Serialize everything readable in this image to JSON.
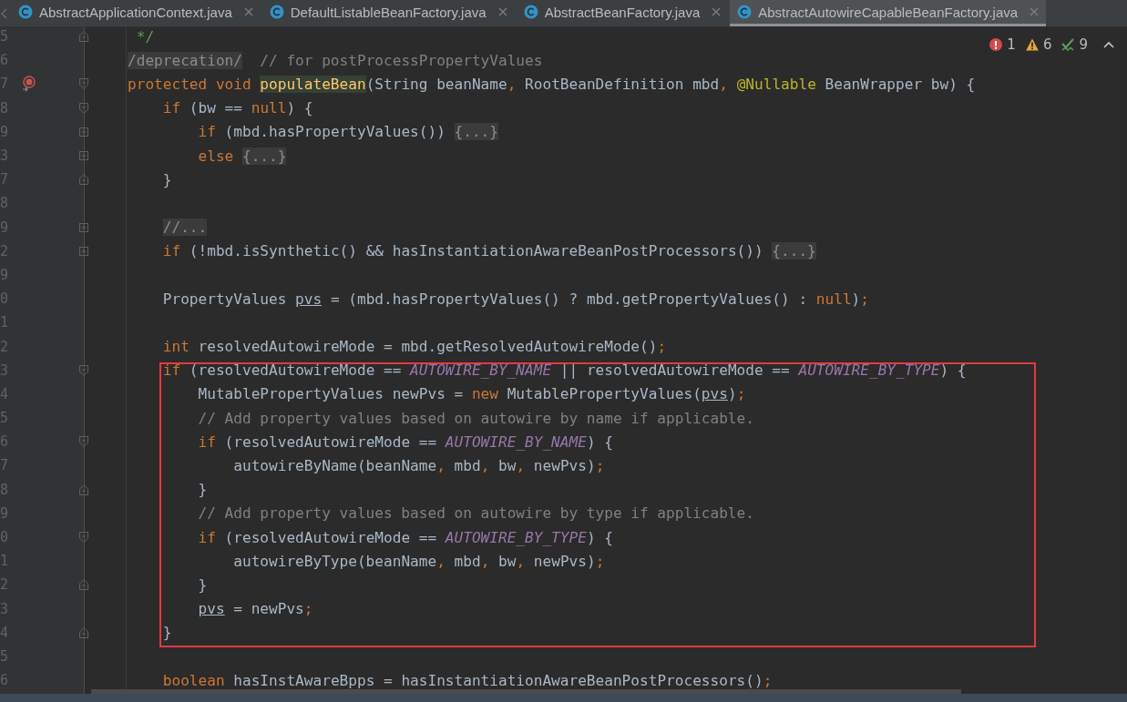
{
  "tabs": [
    {
      "label": "AbstractApplicationContext.java",
      "selected": false
    },
    {
      "label": "DefaultListableBeanFactory.java",
      "selected": false
    },
    {
      "label": "AbstractBeanFactory.java",
      "selected": false
    },
    {
      "label": "AbstractAutowireCapableBeanFactory.java",
      "selected": true
    }
  ],
  "inspections": {
    "errors": "1",
    "warnings": "6",
    "weak_warnings": "9"
  },
  "lines": [
    {
      "number": "5",
      "fold_end": true,
      "tokens": [
        {
          "kind": "doc",
          "text": " */"
        }
      ]
    },
    {
      "number": "6",
      "tokens": [
        {
          "kind": "fold",
          "text": "/deprecation/"
        },
        {
          "kind": "comment",
          "text": "  // for postProcessPropertyValues"
        }
      ]
    },
    {
      "number": "7",
      "override_marker": true,
      "fold_start": true,
      "tokens": [
        {
          "kind": "keyword",
          "text": "protected void "
        },
        {
          "kind": "declaration",
          "text": "populateBean"
        },
        {
          "kind": "plain",
          "text": "(String beanName"
        },
        {
          "kind": "punct",
          "text": ","
        },
        {
          "kind": "plain",
          "text": " RootBeanDefinition mbd"
        },
        {
          "kind": "punct",
          "text": ", "
        },
        {
          "kind": "annotation",
          "text": "@Nullable"
        },
        {
          "kind": "plain",
          "text": " BeanWrapper bw) {"
        }
      ]
    },
    {
      "number": "8",
      "fold_start": true,
      "tokens": [
        {
          "kind": "keyword",
          "text": "    if"
        },
        {
          "kind": "plain",
          "text": " (bw == "
        },
        {
          "kind": "keyword",
          "text": "null"
        },
        {
          "kind": "plain",
          "text": ") {"
        }
      ]
    },
    {
      "number": "9",
      "collapsed": true,
      "tokens": [
        {
          "kind": "keyword",
          "text": "        if"
        },
        {
          "kind": "plain",
          "text": " (mbd.hasPropertyValues()) "
        },
        {
          "kind": "fold",
          "text": "{...}"
        }
      ]
    },
    {
      "number": "3",
      "collapsed": true,
      "tokens": [
        {
          "kind": "keyword",
          "text": "        else "
        },
        {
          "kind": "fold",
          "text": "{...}"
        }
      ]
    },
    {
      "number": "7",
      "fold_end": true,
      "tokens": [
        {
          "kind": "plain",
          "text": "    }"
        }
      ]
    },
    {
      "number": "8"
    },
    {
      "number": "9",
      "collapsed": true,
      "tokens": [
        {
          "kind": "fold",
          "text": "    //..."
        }
      ]
    },
    {
      "number": "2",
      "collapsed": true,
      "tokens": [
        {
          "kind": "keyword",
          "text": "    if"
        },
        {
          "kind": "plain",
          "text": " (!mbd.isSynthetic() && hasInstantiationAwareBeanPostProcessors()) "
        },
        {
          "kind": "fold",
          "text": "{...}"
        }
      ]
    },
    {
      "number": "9"
    },
    {
      "number": "0",
      "tokens": [
        {
          "kind": "plain",
          "text": "    PropertyValues "
        },
        {
          "kind": "unused",
          "text": "pvs"
        },
        {
          "kind": "plain",
          "text": " = (mbd.hasPropertyValues() ? mbd.getPropertyValues() : "
        },
        {
          "kind": "keyword",
          "text": "null"
        },
        {
          "kind": "plain",
          "text": ")"
        },
        {
          "kind": "punct",
          "text": ";"
        }
      ]
    },
    {
      "number": "1"
    },
    {
      "number": "2",
      "tokens": [
        {
          "kind": "keyword",
          "text": "    int"
        },
        {
          "kind": "plain",
          "text": " resolvedAutowireMode = mbd.getResolvedAutowireMode()"
        },
        {
          "kind": "punct",
          "text": ";"
        }
      ]
    },
    {
      "number": "3",
      "fold_start": true,
      "tokens": [
        {
          "kind": "keyword",
          "text": "    if"
        },
        {
          "kind": "plain",
          "text": " (resolvedAutowireMode == "
        },
        {
          "kind": "constant",
          "text": "AUTOWIRE_BY_NAME"
        },
        {
          "kind": "plain",
          "text": " || resolvedAutowireMode == "
        },
        {
          "kind": "constant",
          "text": "AUTOWIRE_BY_TYPE"
        },
        {
          "kind": "plain",
          "text": ") {"
        }
      ]
    },
    {
      "number": "4",
      "tokens": [
        {
          "kind": "plain",
          "text": "        MutablePropertyValues newPvs = "
        },
        {
          "kind": "keyword",
          "text": "new"
        },
        {
          "kind": "plain",
          "text": " MutablePropertyValues("
        },
        {
          "kind": "unused",
          "text": "pvs"
        },
        {
          "kind": "plain",
          "text": ")"
        },
        {
          "kind": "punct",
          "text": ";"
        }
      ]
    },
    {
      "number": "5",
      "tokens": [
        {
          "kind": "comment",
          "text": "        // Add property values based on autowire by name if applicable."
        }
      ]
    },
    {
      "number": "6",
      "fold_start": true,
      "tokens": [
        {
          "kind": "keyword",
          "text": "        if"
        },
        {
          "kind": "plain",
          "text": " (resolvedAutowireMode == "
        },
        {
          "kind": "constant",
          "text": "AUTOWIRE_BY_NAME"
        },
        {
          "kind": "plain",
          "text": ") {"
        }
      ]
    },
    {
      "number": "7",
      "tokens": [
        {
          "kind": "plain",
          "text": "            autowireByName(beanName"
        },
        {
          "kind": "punct",
          "text": ","
        },
        {
          "kind": "plain",
          "text": " mbd"
        },
        {
          "kind": "punct",
          "text": ","
        },
        {
          "kind": "plain",
          "text": " bw"
        },
        {
          "kind": "punct",
          "text": ","
        },
        {
          "kind": "plain",
          "text": " newPvs)"
        },
        {
          "kind": "punct",
          "text": ";"
        }
      ]
    },
    {
      "number": "8",
      "fold_end": true,
      "tokens": [
        {
          "kind": "plain",
          "text": "        }"
        }
      ]
    },
    {
      "number": "9",
      "tokens": [
        {
          "kind": "comment",
          "text": "        // Add property values based on autowire by type if applicable."
        }
      ]
    },
    {
      "number": "0",
      "fold_start": true,
      "tokens": [
        {
          "kind": "keyword",
          "text": "        if"
        },
        {
          "kind": "plain",
          "text": " (resolvedAutowireMode == "
        },
        {
          "kind": "constant",
          "text": "AUTOWIRE_BY_TYPE"
        },
        {
          "kind": "plain",
          "text": ") {"
        }
      ]
    },
    {
      "number": "1",
      "tokens": [
        {
          "kind": "plain",
          "text": "            autowireByType(beanName"
        },
        {
          "kind": "punct",
          "text": ","
        },
        {
          "kind": "plain",
          "text": " mbd"
        },
        {
          "kind": "punct",
          "text": ","
        },
        {
          "kind": "plain",
          "text": " bw"
        },
        {
          "kind": "punct",
          "text": ","
        },
        {
          "kind": "plain",
          "text": " newPvs)"
        },
        {
          "kind": "punct",
          "text": ";"
        }
      ]
    },
    {
      "number": "2",
      "fold_end": true,
      "tokens": [
        {
          "kind": "plain",
          "text": "        }"
        }
      ]
    },
    {
      "number": "3",
      "tokens": [
        {
          "kind": "unused",
          "text": "        pvs"
        },
        {
          "kind": "plain",
          "text": " = newPvs"
        },
        {
          "kind": "punct",
          "text": ";"
        }
      ]
    },
    {
      "number": "4",
      "fold_end": true,
      "tokens": [
        {
          "kind": "plain",
          "text": "    }"
        }
      ]
    },
    {
      "number": "5"
    },
    {
      "number": "6",
      "tokens": [
        {
          "kind": "keyword",
          "text": "    boolean"
        },
        {
          "kind": "plain",
          "text": " hasInstAwareBpps = hasInstantiationAwareBeanPostProcessors()"
        },
        {
          "kind": "punct",
          "text": ";"
        }
      ]
    }
  ]
}
